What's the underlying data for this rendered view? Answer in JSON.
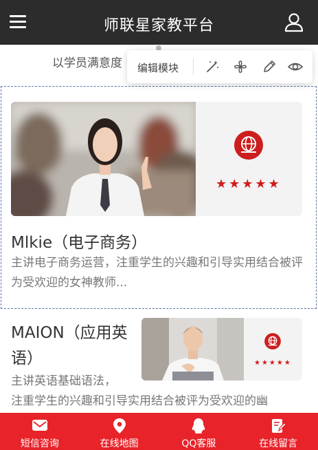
{
  "header": {
    "title": "师联星家教平台"
  },
  "subtitle": "以学员满意度",
  "edit_toolbar": {
    "label": "编辑模块"
  },
  "cards": [
    {
      "title": "Mlkie（电子商务）",
      "description": "主讲电子商务运营，注重学生的兴趣和引导实用结合被评为受欢迎的女神教师...",
      "rating_stars": "★★★★★"
    },
    {
      "title": "MAION（应用英语）",
      "description_line1": "主讲英语基础语法，",
      "description_line2": "注重学生的兴趣和引导实用结合被评为受欢迎的幽",
      "rating_stars": "★★★★★"
    }
  ],
  "bottom_nav": [
    {
      "label": "短信咨询",
      "icon": "mail-icon"
    },
    {
      "label": "在线地图",
      "icon": "map-pin-icon"
    },
    {
      "label": "QQ客服",
      "icon": "qq-icon"
    },
    {
      "label": "在线留言",
      "icon": "note-edit-icon"
    }
  ],
  "colors": {
    "header_bg": "#2c2c2c",
    "nav_bg": "#e8232a",
    "accent_red": "#d11b1b",
    "selection_border": "#5b6fb0"
  }
}
